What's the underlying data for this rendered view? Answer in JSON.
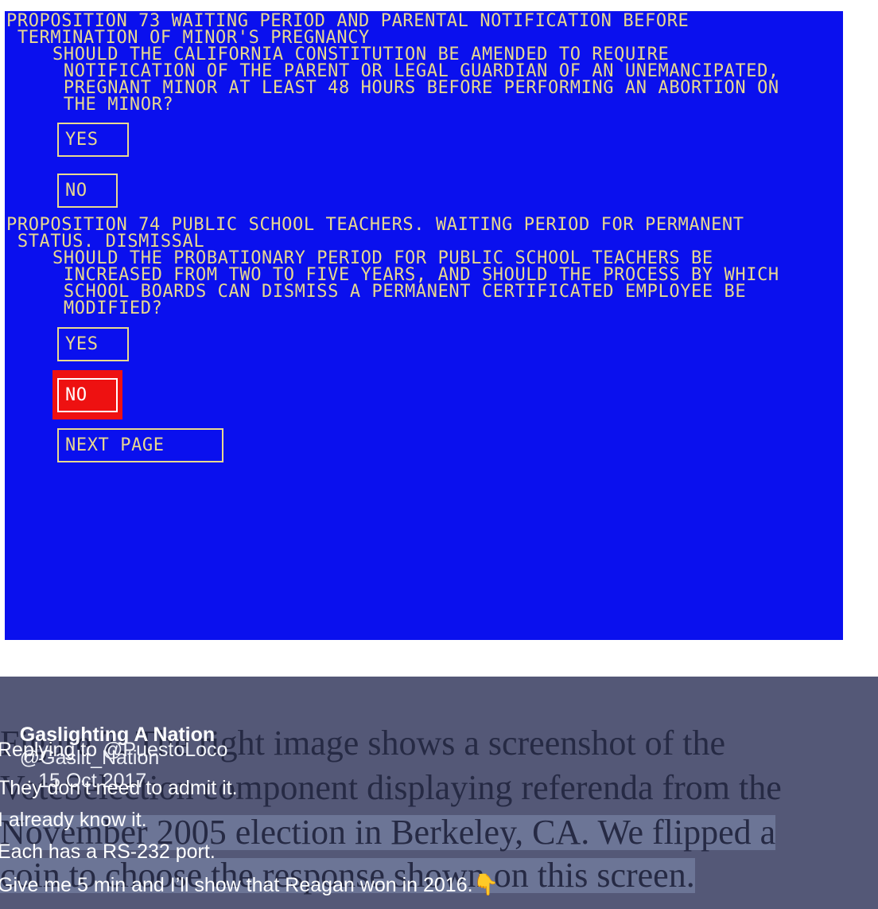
{
  "ballot": {
    "prop73": {
      "title_lines": [
        "PROPOSITION 73 WAITING PERIOD AND PARENTAL NOTIFICATION BEFORE",
        " TERMINATION OF MINOR'S PREGNANCY"
      ],
      "question_lines": [
        "SHOULD THE CALIFORNIA CONSTITUTION BE AMENDED TO REQUIRE",
        " NOTIFICATION OF THE PARENT OR LEGAL GUARDIAN OF AN UNEMANCIPATED,",
        " PREGNANT MINOR AT LEAST 48 HOURS BEFORE PERFORMING AN ABORTION ON",
        " THE MINOR?"
      ],
      "yes_label": "YES",
      "no_label": "NO"
    },
    "prop74": {
      "title_lines": [
        "PROPOSITION 74 PUBLIC SCHOOL TEACHERS. WAITING PERIOD FOR PERMANENT",
        " STATUS. DISMISSAL"
      ],
      "question_lines": [
        "SHOULD THE PROBATIONARY PERIOD FOR PUBLIC SCHOOL TEACHERS BE",
        " INCREASED FROM TWO TO FIVE YEARS, AND SHOULD THE PROCESS BY WHICH",
        " SCHOOL BOARDS CAN DISMISS A PERMANENT CERTIFICATED EMPLOYEE BE",
        " MODIFIED?"
      ],
      "yes_label": "YES",
      "no_label": "NO",
      "selected": "NO"
    },
    "next_page_label": "NEXT PAGE",
    "colors": {
      "screen": "#0a10ee",
      "text": "#e9d98f",
      "selection": "#ee1111"
    }
  },
  "tweet": {
    "author_name": "Gaslighting A Nation",
    "author_handle": "@Gaslit_Nation",
    "date": "· 15 Oct 2017",
    "replying_prefix": "Replying to ",
    "replying_to": "@PuestoLoco",
    "lines": [
      "They don’t need to admit it.",
      "I already know it.",
      "Each has a RS-232 port.",
      "Give me 5 min and I’ll show that Reagan won in 2016."
    ],
    "emoji": "👇",
    "emoji_name": "pointing-down-hand-icon",
    "background_text_lines": [
      "Figure 7: The right image shows a screenshot of the",
      "VoteSelection component displaying referenda from the",
      "November 2005 election in Berkeley, CA. We flipped a",
      "coin to choose the response shown on this screen."
    ]
  }
}
